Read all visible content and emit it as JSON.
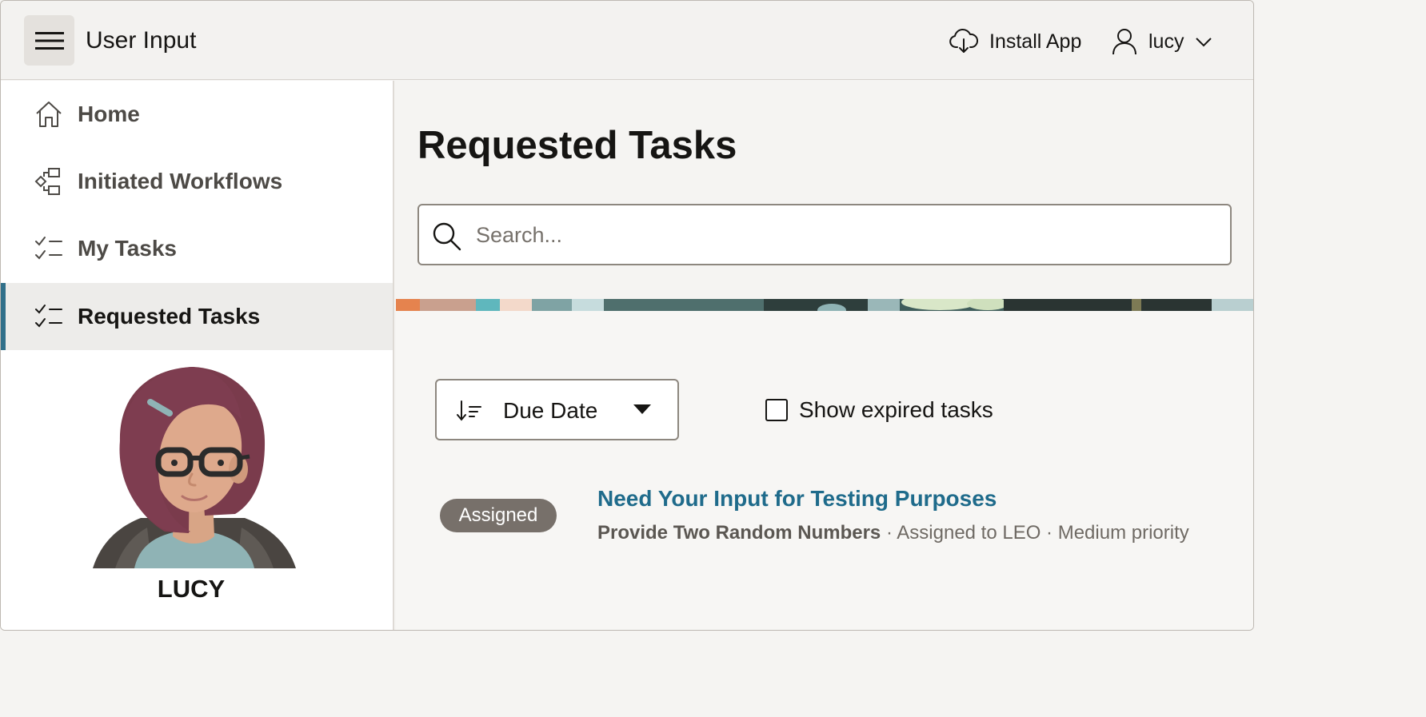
{
  "header": {
    "app_title": "User Input",
    "install_label": "Install App",
    "user_name": "lucy"
  },
  "sidebar": {
    "items": [
      {
        "label": "Home",
        "icon": "home-icon"
      },
      {
        "label": "Initiated Workflows",
        "icon": "workflow-icon"
      },
      {
        "label": "My Tasks",
        "icon": "checklist-icon"
      },
      {
        "label": "Requested Tasks",
        "icon": "checklist-icon",
        "active": true
      }
    ],
    "profile_name": "LUCY"
  },
  "main": {
    "title": "Requested Tasks",
    "search_placeholder": "Search...",
    "sort_label": "Due Date",
    "expired_label": "Show expired tasks",
    "tasks": [
      {
        "status": "Assigned",
        "title": "Need Your Input for Testing Purposes",
        "activity": "Provide Two Random Numbers",
        "assignment": " · Assigned to LEO · Medium priority"
      }
    ]
  },
  "colors": {
    "accent": "#31708a",
    "link": "#1f6b8b",
    "badge": "#77706a"
  }
}
